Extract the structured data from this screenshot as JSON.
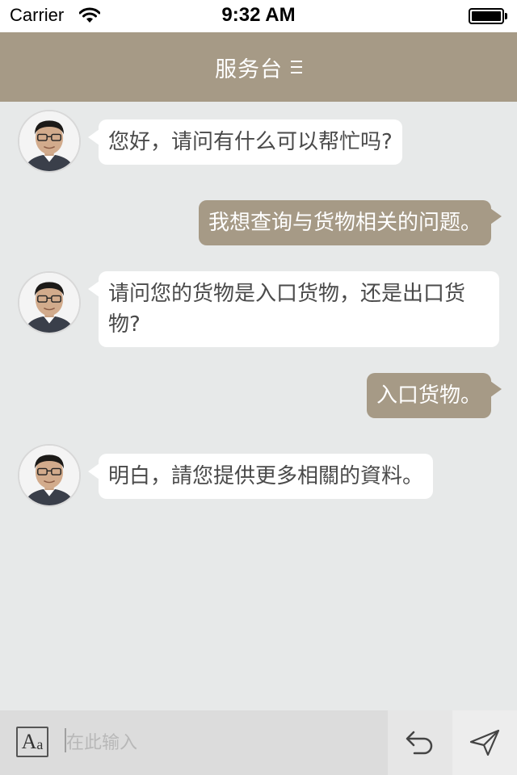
{
  "status_bar": {
    "carrier": "Carrier",
    "time": "9:32 AM"
  },
  "nav": {
    "title": "服务台",
    "menu_icon": "menu-icon"
  },
  "messages": [
    {
      "direction": "in",
      "text": "您好，请问有什么可以帮忙吗?"
    },
    {
      "direction": "out",
      "text": "我想查询与货物相关的问题。"
    },
    {
      "direction": "in",
      "text": "请问您的货物是入口货物，还是出口货物?"
    },
    {
      "direction": "out",
      "text": "入口货物。"
    },
    {
      "direction": "in",
      "text": "明白，請您提供更多相關的資料。"
    }
  ],
  "input": {
    "placeholder": "在此输入",
    "value": ""
  },
  "colors": {
    "accent": "#a69a86",
    "background": "#e7e9e9",
    "incoming_bubble": "#ffffff",
    "input_bar": "#dcdcdc"
  },
  "icons": {
    "font": "font-size-icon",
    "undo": "undo-icon",
    "send": "send-icon"
  }
}
